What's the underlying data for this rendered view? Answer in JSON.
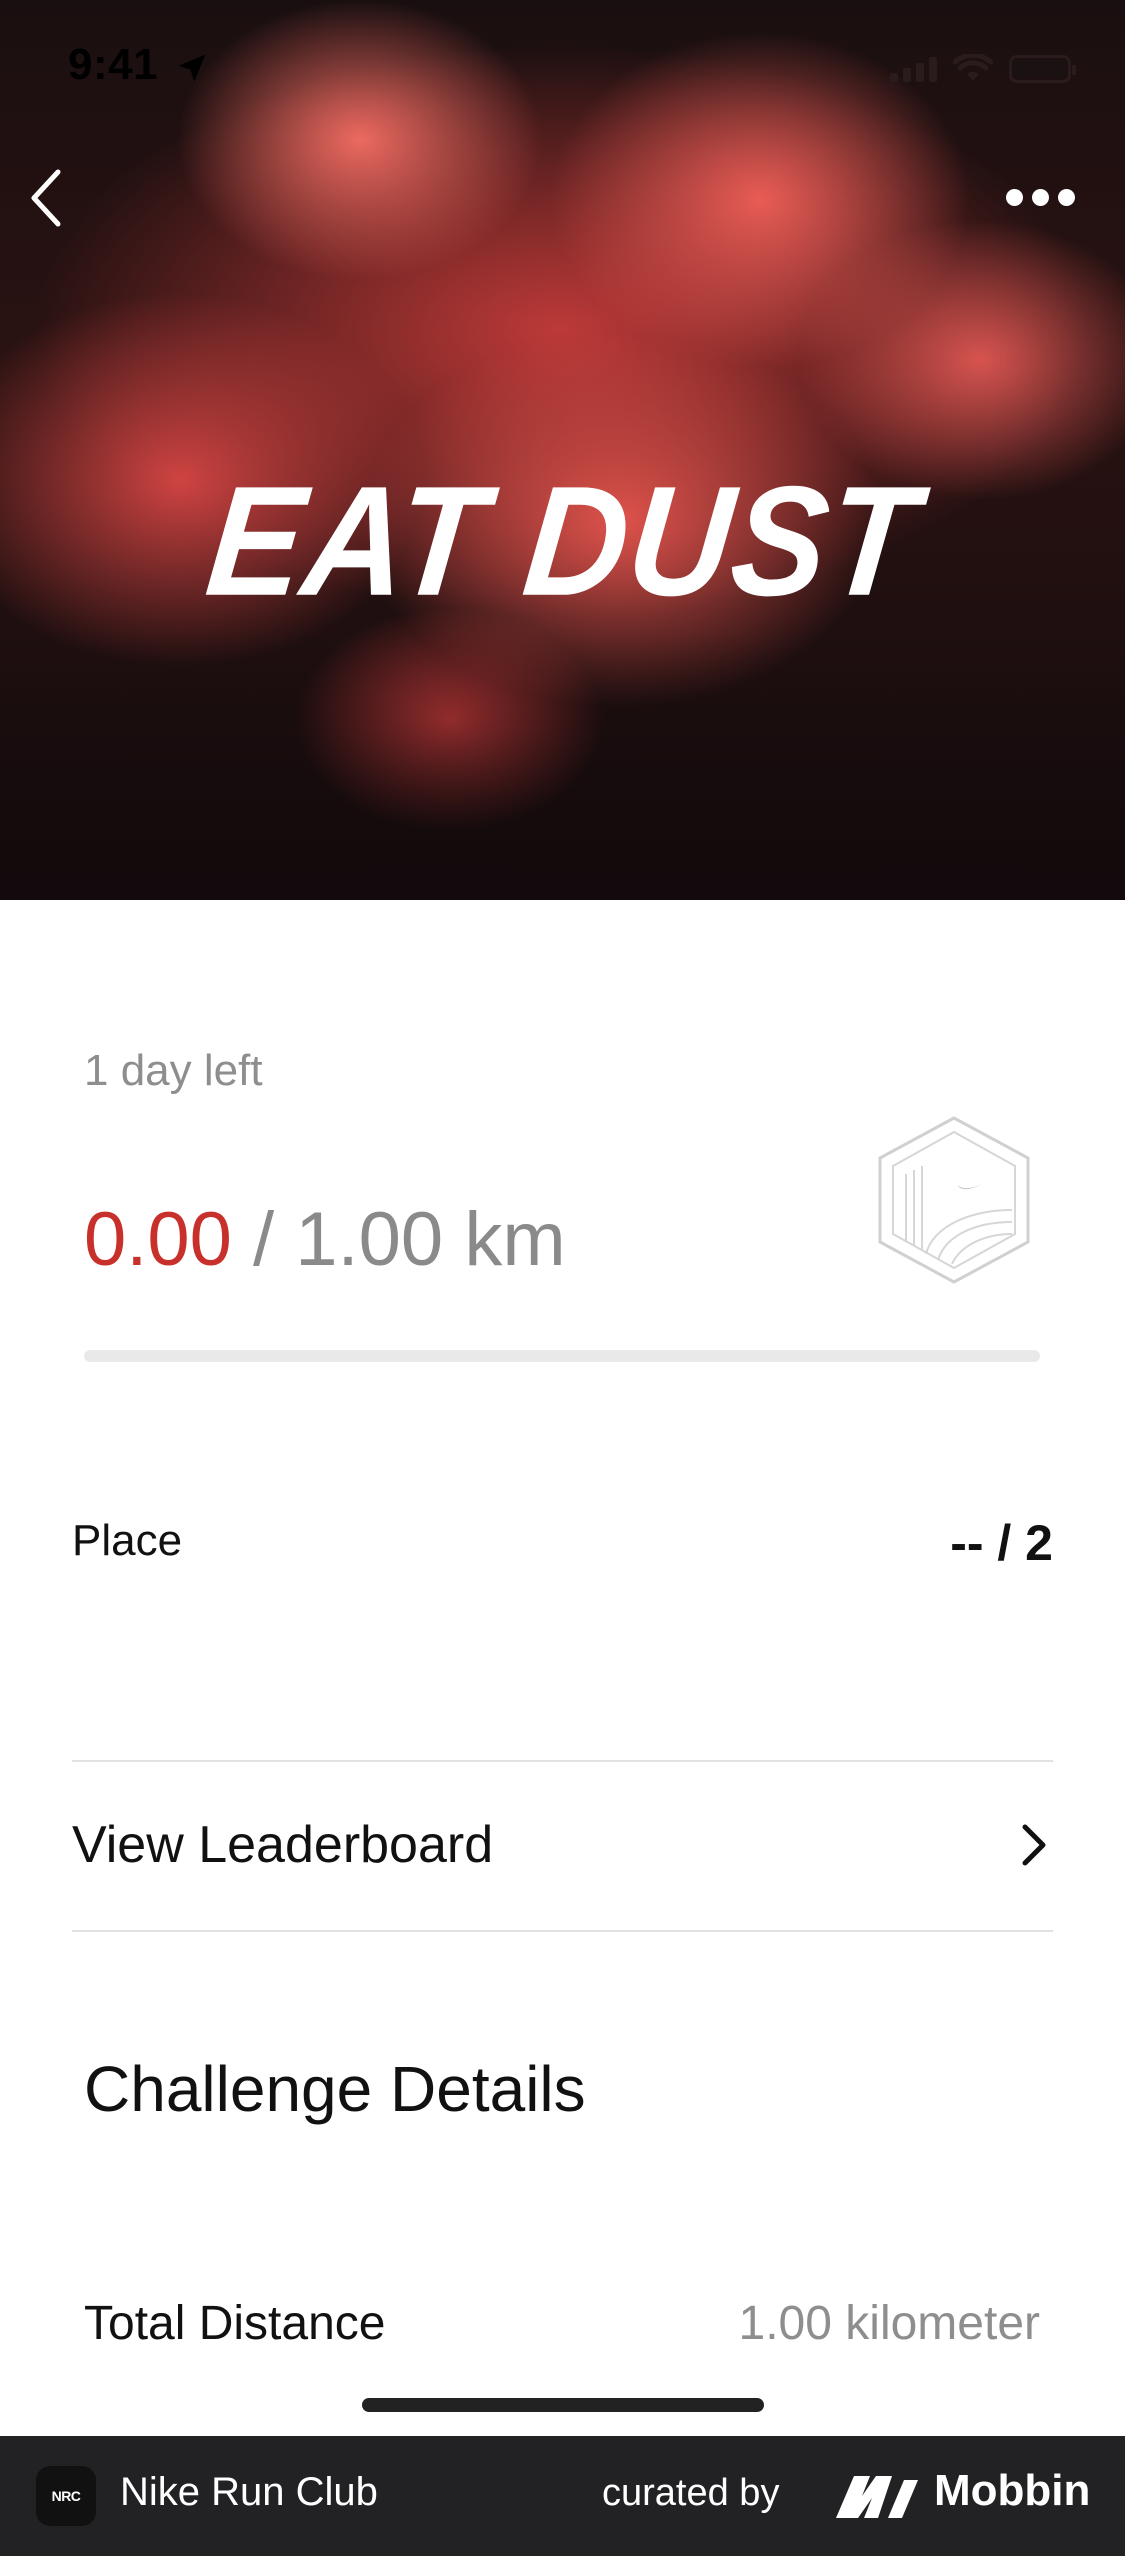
{
  "status_bar": {
    "time": "9:41"
  },
  "hero": {
    "title": "EAT DUST"
  },
  "challenge": {
    "days_left": "1 day left",
    "distance_current": "0.00",
    "distance_separator": " / ",
    "distance_goal": "1.00 km",
    "progress_fraction": 0.0
  },
  "place": {
    "label": "Place",
    "value": "-- / 2"
  },
  "leaderboard": {
    "label": "View Leaderboard"
  },
  "details": {
    "title": "Challenge Details",
    "rows": [
      {
        "label": "Total Distance",
        "value": "1.00 kilometer"
      }
    ]
  },
  "footer": {
    "app_icon_text": "NRC",
    "app_name": "Nike Run Club",
    "curated_by": "curated by",
    "brand": "Mobbin"
  },
  "colors": {
    "accent": "#c8312b",
    "muted": "#8e8e8e",
    "footer_bg": "#222224"
  },
  "icons": {
    "back": "chevron-left-icon",
    "more": "more-dots-icon",
    "badge": "nike-hexagon-badge-icon",
    "leaderboard_chevron": "chevron-right-icon",
    "location": "location-arrow-icon"
  }
}
